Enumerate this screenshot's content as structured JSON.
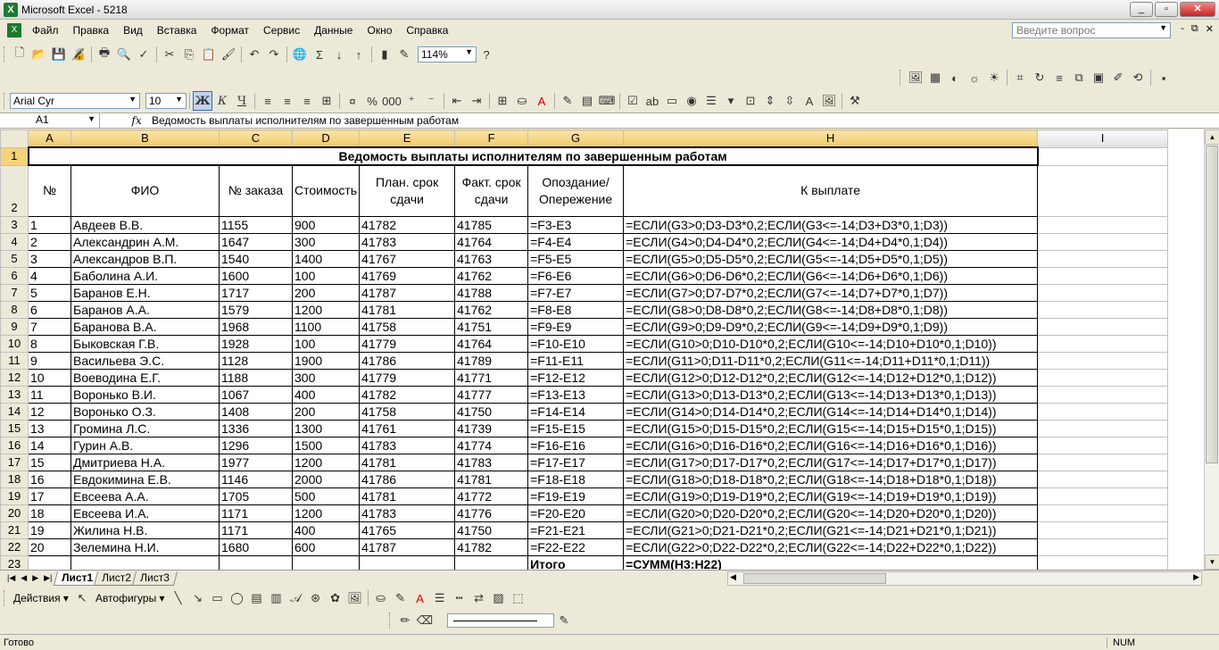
{
  "window": {
    "title": "Microsoft Excel - 5218",
    "app_icon": "X",
    "controls": [
      "_",
      "▫",
      "✕"
    ]
  },
  "menu": {
    "items": [
      "Файл",
      "Правка",
      "Вид",
      "Вставка",
      "Формат",
      "Сервис",
      "Данные",
      "Окно",
      "Справка"
    ],
    "help_placeholder": "Введите вопрос",
    "doc_controls": [
      "-",
      "⧉",
      "✕"
    ]
  },
  "toolbar": {
    "zoom": "114%",
    "font_name": "Arial Cyr",
    "font_size": "10",
    "bold": "Ж",
    "italic": "К",
    "underline": "Ч"
  },
  "formula_bar": {
    "cell_ref": "A1",
    "fx": "fx",
    "content": "Ведомость выплаты исполнителям по завершенным работам"
  },
  "grid": {
    "columns": [
      "A",
      "B",
      "C",
      "D",
      "E",
      "F",
      "G",
      "H",
      "I"
    ],
    "title": "Ведомость выплаты исполнителям по завершенным работам",
    "headers": {
      "a": "№",
      "b": "ФИО",
      "c": "№ заказа",
      "d": "Стоимость",
      "e": "План. срок сдачи",
      "f": "Факт. срок сдачи",
      "g": "Опоздание/Опережение",
      "h": "К выплате"
    },
    "rows": [
      [
        "1",
        "Авдеев В.В.",
        "1155",
        "900",
        "41782",
        "41785",
        "=F3-E3",
        "=ЕСЛИ(G3>0;D3-D3*0,2;ЕСЛИ(G3<=-14;D3+D3*0,1;D3))"
      ],
      [
        "2",
        "Александрин А.М.",
        "1647",
        "300",
        "41783",
        "41764",
        "=F4-E4",
        "=ЕСЛИ(G4>0;D4-D4*0,2;ЕСЛИ(G4<=-14;D4+D4*0,1;D4))"
      ],
      [
        "3",
        "Александров В.П.",
        "1540",
        "1400",
        "41767",
        "41763",
        "=F5-E5",
        "=ЕСЛИ(G5>0;D5-D5*0,2;ЕСЛИ(G5<=-14;D5+D5*0,1;D5))"
      ],
      [
        "4",
        "Баболина А.И.",
        "1600",
        "100",
        "41769",
        "41762",
        "=F6-E6",
        "=ЕСЛИ(G6>0;D6-D6*0,2;ЕСЛИ(G6<=-14;D6+D6*0,1;D6))"
      ],
      [
        "5",
        "Баранов Е.Н.",
        "1717",
        "200",
        "41787",
        "41788",
        "=F7-E7",
        "=ЕСЛИ(G7>0;D7-D7*0,2;ЕСЛИ(G7<=-14;D7+D7*0,1;D7))"
      ],
      [
        "6",
        "Баранов А.А.",
        "1579",
        "1200",
        "41781",
        "41762",
        "=F8-E8",
        "=ЕСЛИ(G8>0;D8-D8*0,2;ЕСЛИ(G8<=-14;D8+D8*0,1;D8))"
      ],
      [
        "7",
        "Баранова В.А.",
        "1968",
        "1100",
        "41758",
        "41751",
        "=F9-E9",
        "=ЕСЛИ(G9>0;D9-D9*0,2;ЕСЛИ(G9<=-14;D9+D9*0,1;D9))"
      ],
      [
        "8",
        "Быковская Г.В.",
        "1928",
        "100",
        "41779",
        "41764",
        "=F10-E10",
        "=ЕСЛИ(G10>0;D10-D10*0,2;ЕСЛИ(G10<=-14;D10+D10*0,1;D10))"
      ],
      [
        "9",
        "Васильева Э.С.",
        "1128",
        "1900",
        "41786",
        "41789",
        "=F11-E11",
        "=ЕСЛИ(G11>0;D11-D11*0,2;ЕСЛИ(G11<=-14;D11+D11*0,1;D11))"
      ],
      [
        "10",
        "Воеводина Е.Г.",
        "1188",
        "300",
        "41779",
        "41771",
        "=F12-E12",
        "=ЕСЛИ(G12>0;D12-D12*0,2;ЕСЛИ(G12<=-14;D12+D12*0,1;D12))"
      ],
      [
        "11",
        "Воронько В.И.",
        "1067",
        "400",
        "41782",
        "41777",
        "=F13-E13",
        "=ЕСЛИ(G13>0;D13-D13*0,2;ЕСЛИ(G13<=-14;D13+D13*0,1;D13))"
      ],
      [
        "12",
        "Воронько О.З.",
        "1408",
        "200",
        "41758",
        "41750",
        "=F14-E14",
        "=ЕСЛИ(G14>0;D14-D14*0,2;ЕСЛИ(G14<=-14;D14+D14*0,1;D14))"
      ],
      [
        "13",
        "Громина Л.С.",
        "1336",
        "1300",
        "41761",
        "41739",
        "=F15-E15",
        "=ЕСЛИ(G15>0;D15-D15*0,2;ЕСЛИ(G15<=-14;D15+D15*0,1;D15))"
      ],
      [
        "14",
        "Гурин А.В.",
        "1296",
        "1500",
        "41783",
        "41774",
        "=F16-E16",
        "=ЕСЛИ(G16>0;D16-D16*0,2;ЕСЛИ(G16<=-14;D16+D16*0,1;D16))"
      ],
      [
        "15",
        "Дмитриева Н.А.",
        "1977",
        "1200",
        "41781",
        "41783",
        "=F17-E17",
        "=ЕСЛИ(G17>0;D17-D17*0,2;ЕСЛИ(G17<=-14;D17+D17*0,1;D17))"
      ],
      [
        "16",
        "Евдокимина Е.В.",
        "1146",
        "2000",
        "41786",
        "41781",
        "=F18-E18",
        "=ЕСЛИ(G18>0;D18-D18*0,2;ЕСЛИ(G18<=-14;D18+D18*0,1;D18))"
      ],
      [
        "17",
        "Евсеева А.А.",
        "1705",
        "500",
        "41781",
        "41772",
        "=F19-E19",
        "=ЕСЛИ(G19>0;D19-D19*0,2;ЕСЛИ(G19<=-14;D19+D19*0,1;D19))"
      ],
      [
        "18",
        "Евсеева И.А.",
        "1171",
        "1200",
        "41783",
        "41776",
        "=F20-E20",
        "=ЕСЛИ(G20>0;D20-D20*0,2;ЕСЛИ(G20<=-14;D20+D20*0,1;D20))"
      ],
      [
        "19",
        "Жилина Н.В.",
        "1171",
        "400",
        "41765",
        "41750",
        "=F21-E21",
        "=ЕСЛИ(G21>0;D21-D21*0,2;ЕСЛИ(G21<=-14;D21+D21*0,1;D21))"
      ],
      [
        "20",
        "Зелемина Н.И.",
        "1680",
        "600",
        "41787",
        "41782",
        "=F22-E22",
        "=ЕСЛИ(G22>0;D22-D22*0,2;ЕСЛИ(G22<=-14;D22+D22*0,1;D22))"
      ]
    ],
    "total_label": "Итого",
    "total_formula": "=СУММ(H3:H22)"
  },
  "sheets": [
    "Лист1",
    "Лист2",
    "Лист3"
  ],
  "drawing": {
    "actions": "Действия ▾",
    "autoshapes": "Автофигуры ▾"
  },
  "status": {
    "ready": "Готово",
    "num": "NUM"
  },
  "colors": {
    "fill": "#ffff00",
    "line": "#0000ff",
    "font": "#ff0000"
  }
}
